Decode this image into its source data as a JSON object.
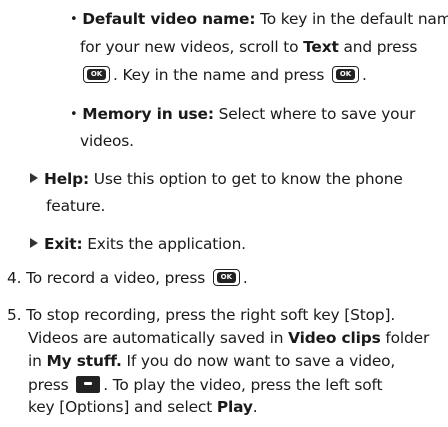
{
  "icons": {
    "ok_key_text": "OK"
  },
  "bullet_symbol": "•",
  "sub_bullets": [
    {
      "label": "Default video name:",
      "line1_after": " To key in the default name",
      "line2": "for your new videos, scroll to ",
      "line2_bold": "Text",
      "line2_after": " and press",
      "line3_a": ". Key in the name and press",
      "line3_b": "."
    },
    {
      "label": "Memory in use:",
      "line1_after": " Select where to save your",
      "line2": "videos."
    }
  ],
  "options": [
    {
      "label": "Help:",
      "text": " Use this option to get to know the phone",
      "line2": "feature."
    },
    {
      "label": "Exit:",
      "text": " Exits the application."
    }
  ],
  "steps": [
    {
      "number": "4.",
      "text_a": "To record a video, press",
      "text_b": "."
    },
    {
      "number": "5.",
      "line1": "To stop recording, press the right soft key [Stop].",
      "line2_a": "Videos are automatically saved in ",
      "line2_bold": "Video clips",
      "line2_b": " folder",
      "line3_a": "in ",
      "line3_bold": "My stuff.",
      "line3_b": " If you do now want to save a video,",
      "line4_a": "press",
      "line4_b": ". To play the video, press the left soft",
      "line5_a": "key [Options] and select ",
      "line5_bold": "Play",
      "line5_b": "."
    }
  ]
}
